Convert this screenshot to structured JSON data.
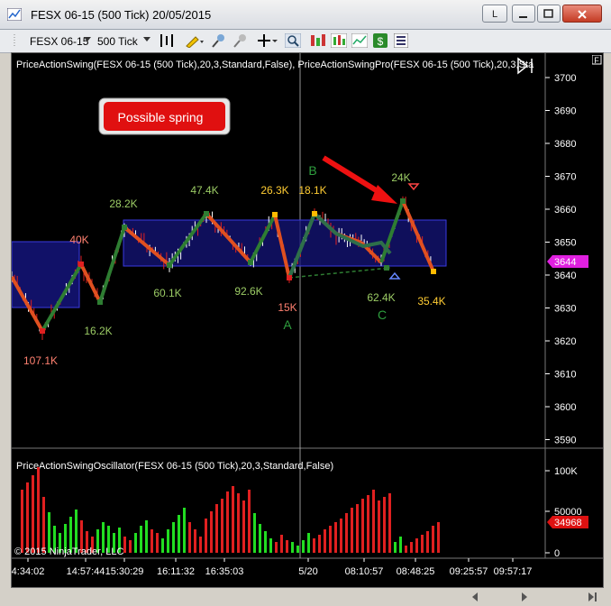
{
  "window": {
    "title": "FESX 06-15 (500 Tick)  20/05/2015",
    "btn_l": "L"
  },
  "toolbar": {
    "instrument": "FESX 06-15",
    "interval": "500 Tick"
  },
  "chart": {
    "indicator_label": "PriceActionSwing(FESX 06-15 (500 Tick),20,3,Standard,False), PriceActionSwingPro(FESX 06-15 (500 Tick),20,3,Sta",
    "annotation_box": "Possible spring",
    "copyright": "© 2015 NinjaTrader, LLC",
    "price_marker": "3644",
    "y_ticks": [
      "3700",
      "3690",
      "3680",
      "3670",
      "3660",
      "3650",
      "3640",
      "3630",
      "3620",
      "3610",
      "3600",
      "3590"
    ],
    "volume_labels": [
      "107.1K",
      "40K",
      "16.2K",
      "28.2K",
      "60.1K",
      "47.4K",
      "92.6K",
      "26.3K",
      "18.1K",
      "15K",
      "62.4K",
      "24K",
      "35.4K"
    ],
    "point_labels": [
      "A",
      "B",
      "C"
    ]
  },
  "oscillator": {
    "label": "PriceActionSwingOscillator(FESX 06-15 (500 Tick),20,3,Standard,False)",
    "y_ticks": [
      "100K",
      "50000",
      "0"
    ],
    "value_marker": "34968"
  },
  "time_axis": [
    "4:34:02",
    "14:57:44",
    "15:30:29",
    "16:11:32",
    "16:35:03",
    "5/20",
    "08:10:57",
    "08:48:25",
    "09:25:57",
    "09:57:17"
  ],
  "colors": {
    "up": "#22cc22",
    "down": "#e02020",
    "swing": "#2e7d32",
    "zone": "#1a1a8a"
  }
}
